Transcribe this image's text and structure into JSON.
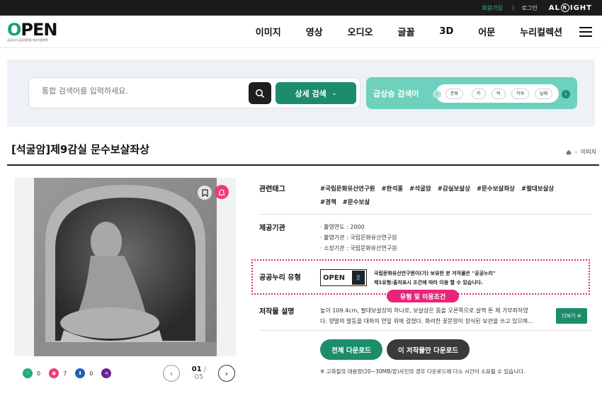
{
  "topbar": {
    "join": "회원가입",
    "login": "로그인",
    "brand": "ALRIGHT"
  },
  "header": {
    "logo_text": "OPEN",
    "logo_sub": "공공누리 공공저작물 자유이용허락",
    "nav": [
      "이미지",
      "영상",
      "오디오",
      "글꼴",
      "3D",
      "어문",
      "누리컬렉션"
    ]
  },
  "search": {
    "placeholder": "통합 검색어를 입력하세요.",
    "detail_label": "상세 검색"
  },
  "rising": {
    "title": "급상승 검색어",
    "keywords": [
      "문화",
      "키",
      "락",
      "키워",
      "달래"
    ]
  },
  "page": {
    "title": "[석굴암]제9감실 문수보살좌상",
    "breadcrumb": "이미지"
  },
  "media": {
    "stats": {
      "likes": "0",
      "views": "7",
      "downloads": "0"
    },
    "pager": {
      "current": "01",
      "total": "/ 05"
    }
  },
  "detail": {
    "tags_label": "관련태그",
    "tags": [
      "#국립문화유산연구원",
      "#한석홍",
      "#석굴암",
      "#감실보살상",
      "#문수보살좌상",
      "#팔대보살상",
      "#경책",
      "#문수보살"
    ],
    "provider_label": "제공기관",
    "provider_lines": [
      "· 촬영연도 : 2000",
      "· 촬영기관 : 국립문화유산연구원",
      "· 소장기관 : 국립문화유산연구원"
    ],
    "license_label": "공공누리 유형",
    "license_logo": "OPEN",
    "license_line1": "국립문화유산연구원이(가) 보유한 본 저작물은 \"공공누리\"",
    "license_line2": "제1유형:출처표시 조건에 따라 이용 할 수 있습니다.",
    "license_tag": "유형 및 이용조건",
    "desc_label": "저작물 설명",
    "desc_line1": "높이 109.4cm, 팔대보살상의 하나로, 보살상은 몸을 오른쪽으로 살짝 튼 채 가부좌하였",
    "desc_line2": "다. 양발의 발등을 대좌의 연잎 위에 걸쳤다. 화려한 꽃문양이 장식된 보관을 쓰고 있으며…",
    "more_label": "더보기 ⊕",
    "download_all": "전체 다운로드",
    "download_one": "이 저작물만 다운로드",
    "note": "※ 고화질의 대용량(20~30MB/장)사진의 경우 다운로드에 다소 시간이 소요될 수 있습니다."
  },
  "colors": {
    "brand_green": "#1d8c6b",
    "accent_pink": "#e8257a",
    "rising_bg": "#6dd1bd"
  }
}
